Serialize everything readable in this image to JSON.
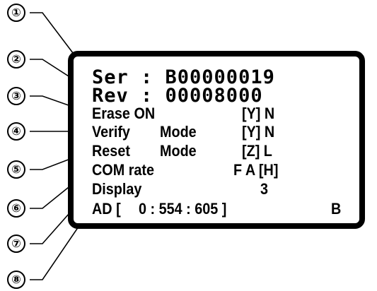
{
  "callouts": [
    "①",
    "②",
    "③",
    "④",
    "⑤",
    "⑥",
    "⑦",
    "⑧"
  ],
  "display": {
    "ser": "Ser : B00000019",
    "rev": "Rev : 00008000",
    "erase_label": "Erase ON",
    "erase_value": "[Y] N",
    "verify_label": "Verify",
    "verify_mode": "Mode",
    "verify_value": "[Y] N",
    "reset_label": "Reset",
    "reset_mode": "Mode",
    "reset_value": "[Z] L",
    "com_label": "COM rate",
    "com_value": "F A [H]",
    "display_label": "Display",
    "display_value": "3",
    "ad_label": "AD [",
    "ad_value": "0 : 554 : 605 ]",
    "ad_suffix": "B"
  }
}
